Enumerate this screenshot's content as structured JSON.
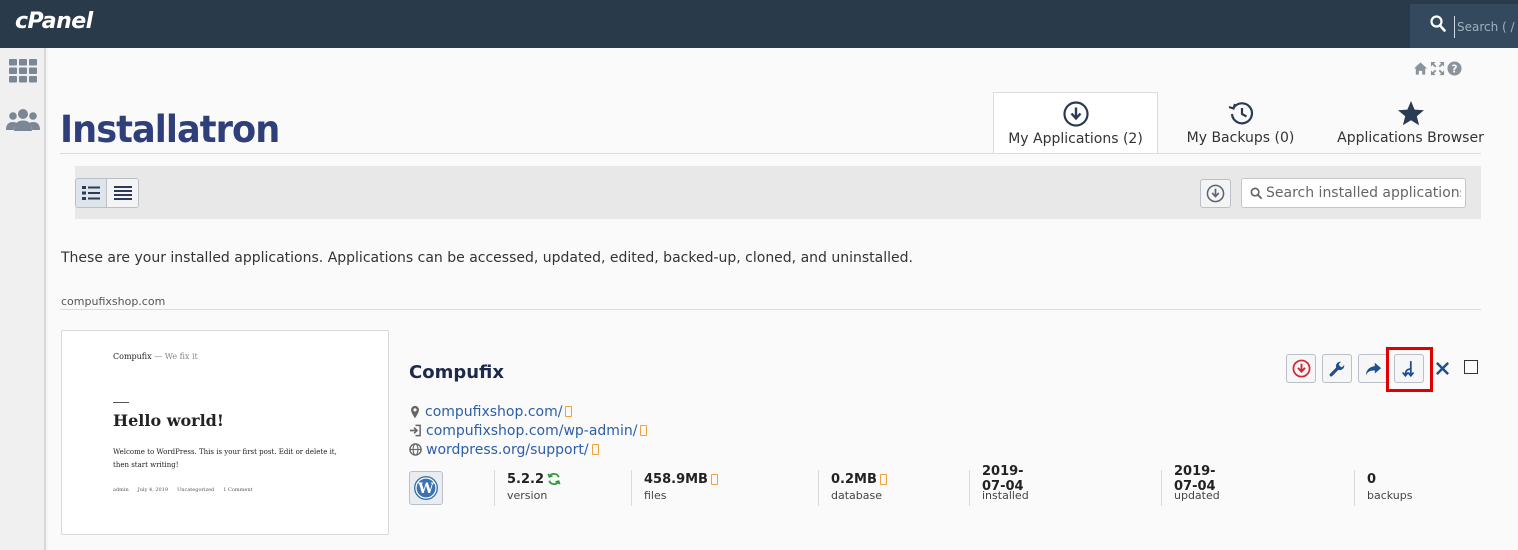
{
  "topbar": {
    "logo": "cPanel",
    "search_placeholder": "Search ( / )"
  },
  "sidebar": {
    "items": [
      {
        "icon": "grid-icon"
      },
      {
        "icon": "users-icon"
      }
    ]
  },
  "header": {
    "brand": "Installatron",
    "util_icons": [
      "home-icon",
      "expand-icon",
      "help-icon"
    ]
  },
  "tabs": [
    {
      "label": "My Applications (2)",
      "icon": "download-circle-icon",
      "active": true
    },
    {
      "label": "My Backups (0)",
      "icon": "history-icon",
      "active": false
    },
    {
      "label": "Applications Browser",
      "icon": "star-icon",
      "active": false
    }
  ],
  "toolbar": {
    "search_placeholder": "Search installed applications"
  },
  "intro": "These are your installed applications. Applications can be accessed, updated, edited, backed-up, cloned, and uninstalled.",
  "domain": "compufixshop.com",
  "thumbnail": {
    "site_title": "Compufix",
    "site_tagline": "— We fix it",
    "post_title": "Hello world!",
    "post_body": "Welcome to WordPress. This is your first post. Edit or delete it, then start writing!",
    "meta": [
      "admin",
      "July 4, 2019",
      "Uncategorized",
      "1 Comment"
    ]
  },
  "app": {
    "name": "Compufix",
    "links": [
      {
        "icon": "map-pin-icon",
        "text": "compufixshop.com/"
      },
      {
        "icon": "sign-in-icon",
        "text": "compufixshop.com/wp-admin/"
      },
      {
        "icon": "globe-icon",
        "text": "wordpress.org/support/"
      }
    ],
    "stats": [
      {
        "value": "5.2.2",
        "label": "version"
      },
      {
        "value": "458.9MB",
        "label": "files"
      },
      {
        "value": "0.2MB",
        "label": "database"
      },
      {
        "value": "2019-07-04",
        "label": "installed"
      },
      {
        "value": "2019-07-04",
        "label": "updated"
      },
      {
        "value": "0",
        "label": "backups"
      }
    ]
  },
  "colors": {
    "topbar": "#293a4a",
    "brand": "#2f3f7a",
    "link": "#2c5ea8",
    "highlight": "#e00000",
    "backup_red": "#d9232e",
    "action_blue": "#1f4f8f"
  }
}
